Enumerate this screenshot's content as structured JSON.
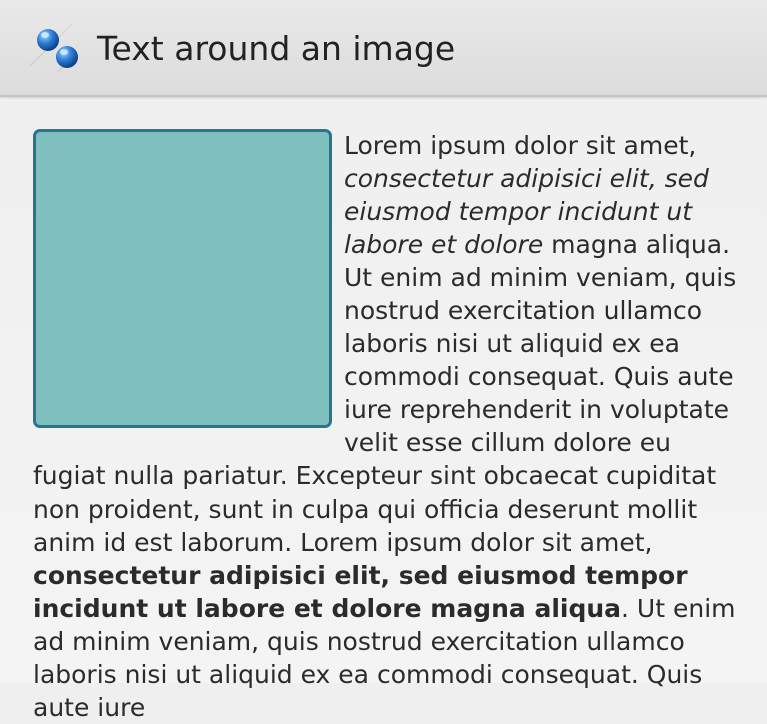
{
  "app": {
    "title": "Text around an image",
    "icon": "pushpin-icon"
  },
  "image": {
    "fill_color": "#80bfc0",
    "border_color": "#23788f"
  },
  "text": {
    "part1": "Lorem ipsum dolor sit amet, ",
    "part2_italic": "consectetur adipisici elit, sed eiusmod tempor incidunt ut labore et dolore",
    "part3": " magna aliqua. Ut enim ad minim veniam, quis nostrud exercitation ullamco laboris nisi ut aliquid ex ea commodi consequat. Quis aute iure reprehenderit in voluptate velit esse cillum dolore eu fugiat nulla pariatur. Excepteur sint obcaecat cupiditat non proident, sunt in culpa qui officia deserunt mollit anim id est laborum. Lorem ipsum dolor sit amet, ",
    "part4_bold": "consectetur adipisici elit, sed eiusmod tempor incidunt ut labore et dolore magna aliqua",
    "part5": ". Ut enim ad minim veniam, quis nostrud exercitation ullamco laboris nisi ut aliquid ex ea commodi consequat. Quis aute iure"
  }
}
